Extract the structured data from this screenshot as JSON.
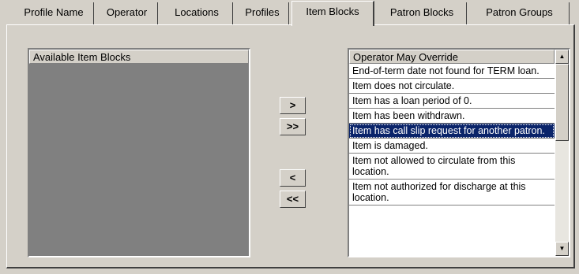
{
  "tabs": [
    {
      "label": "Profile Name"
    },
    {
      "label": "Operator"
    },
    {
      "label": "Locations"
    },
    {
      "label": "Profiles"
    },
    {
      "label": "Item Blocks"
    },
    {
      "label": "Patron Blocks"
    },
    {
      "label": "Patron Groups"
    }
  ],
  "left_list": {
    "header": "Available Item Blocks"
  },
  "right_list": {
    "header": "Operator May Override",
    "items": [
      "End-of-term date not found for TERM loan.",
      "Item does not circulate.",
      "Item has a loan period of 0.",
      "Item has been withdrawn.",
      "Item has call slip request for another patron.",
      "Item is damaged.",
      "Item not allowed to circulate from this location.",
      "Item not authorized for discharge at this location."
    ],
    "selected_index": 4
  },
  "buttons": {
    "add": ">",
    "add_all": ">>",
    "remove": "<",
    "remove_all": "<<"
  },
  "scrollbar": {
    "up_icon": "▲",
    "down_icon": "▼"
  }
}
